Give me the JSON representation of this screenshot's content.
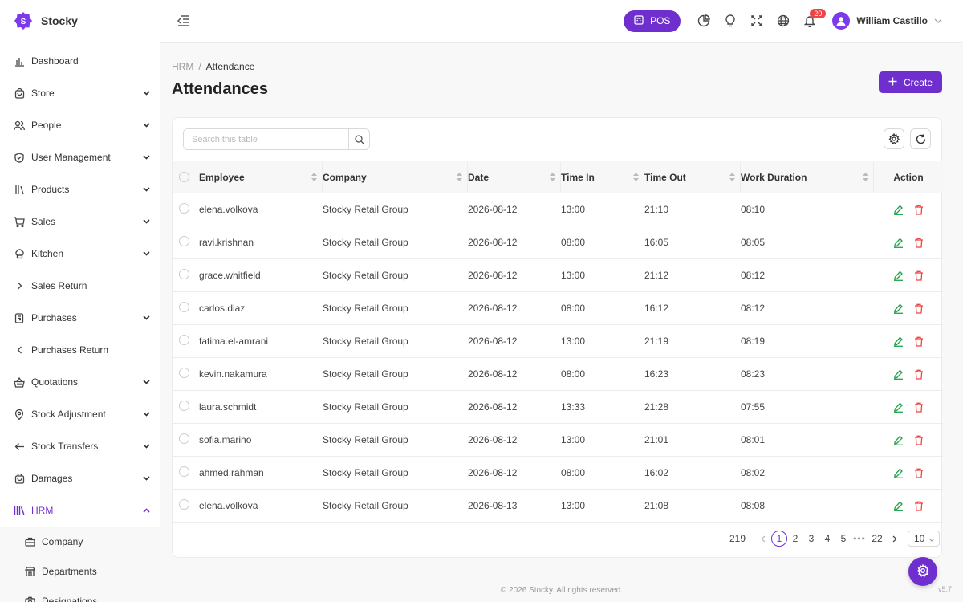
{
  "brand": {
    "name": "Stocky",
    "accent": "#6f2fcf"
  },
  "sidebar": {
    "items": [
      {
        "label": "Dashboard",
        "icon": "bar-chart-icon",
        "chevron": "none"
      },
      {
        "label": "Store",
        "icon": "store-icon",
        "chevron": "down"
      },
      {
        "label": "People",
        "icon": "users-icon",
        "chevron": "down"
      },
      {
        "label": "User Management",
        "icon": "shield-icon",
        "chevron": "down"
      },
      {
        "label": "Products",
        "icon": "books-icon",
        "chevron": "down"
      },
      {
        "label": "Sales",
        "icon": "cart-icon",
        "chevron": "down"
      },
      {
        "label": "Kitchen",
        "icon": "chef-hat-icon",
        "chevron": "down"
      },
      {
        "label": "Sales Return",
        "icon": "chevron-right-icon",
        "chevron": "none"
      },
      {
        "label": "Purchases",
        "icon": "receipt-icon",
        "chevron": "down"
      },
      {
        "label": "Purchases Return",
        "icon": "chevron-left-icon",
        "chevron": "none"
      },
      {
        "label": "Quotations",
        "icon": "basket-icon",
        "chevron": "down"
      },
      {
        "label": "Stock Adjustment",
        "icon": "location-pin-icon",
        "chevron": "down"
      },
      {
        "label": "Stock Transfers",
        "icon": "arrow-left-icon",
        "chevron": "down"
      },
      {
        "label": "Damages",
        "icon": "box-icon",
        "chevron": "down"
      },
      {
        "label": "HRM",
        "icon": "hrm-icon",
        "chevron": "up"
      }
    ],
    "subitems": [
      {
        "label": "Company",
        "icon": "briefcase-icon"
      },
      {
        "label": "Departments",
        "icon": "building-icon"
      },
      {
        "label": "Designations",
        "icon": "camera-icon"
      }
    ]
  },
  "topbar": {
    "pos_label": "POS",
    "notification_count": "20",
    "user_name": "William Castillo"
  },
  "breadcrumb": {
    "parent": "HRM",
    "separator": "/",
    "current": "Attendance"
  },
  "page": {
    "title": "Attendances",
    "create_label": "Create"
  },
  "search": {
    "placeholder": "Search this table"
  },
  "table": {
    "headers": [
      "Employee",
      "Company",
      "Date",
      "Time In",
      "Time Out",
      "Work Duration",
      "Action"
    ],
    "rows": [
      [
        "elena.volkova",
        "Stocky Retail Group",
        "2026-08-12",
        "13:00",
        "21:10",
        "08:10"
      ],
      [
        "ravi.krishnan",
        "Stocky Retail Group",
        "2026-08-12",
        "08:00",
        "16:05",
        "08:05"
      ],
      [
        "grace.whitfield",
        "Stocky Retail Group",
        "2026-08-12",
        "13:00",
        "21:12",
        "08:12"
      ],
      [
        "carlos.diaz",
        "Stocky Retail Group",
        "2026-08-12",
        "08:00",
        "16:12",
        "08:12"
      ],
      [
        "fatima.el-amrani",
        "Stocky Retail Group",
        "2026-08-12",
        "13:00",
        "21:19",
        "08:19"
      ],
      [
        "kevin.nakamura",
        "Stocky Retail Group",
        "2026-08-12",
        "08:00",
        "16:23",
        "08:23"
      ],
      [
        "laura.schmidt",
        "Stocky Retail Group",
        "2026-08-12",
        "13:33",
        "21:28",
        "07:55"
      ],
      [
        "sofia.marino",
        "Stocky Retail Group",
        "2026-08-12",
        "13:00",
        "21:01",
        "08:01"
      ],
      [
        "ahmed.rahman",
        "Stocky Retail Group",
        "2026-08-12",
        "08:00",
        "16:02",
        "08:02"
      ],
      [
        "elena.volkova",
        "Stocky Retail Group",
        "2026-08-13",
        "13:00",
        "21:08",
        "08:08"
      ]
    ]
  },
  "pagination": {
    "total": "219",
    "pages": [
      "1",
      "2",
      "3",
      "4",
      "5"
    ],
    "current": "1",
    "ellipsis": "•••",
    "last": "22",
    "page_size": "10"
  },
  "footer": {
    "copyright": "© 2026 Stocky. All rights reserved.",
    "version": "v5.7"
  },
  "colors": {
    "accent": "#6f2fcf",
    "edit": "#22a34a",
    "delete": "#ef4444",
    "badge": "#ef4444"
  }
}
